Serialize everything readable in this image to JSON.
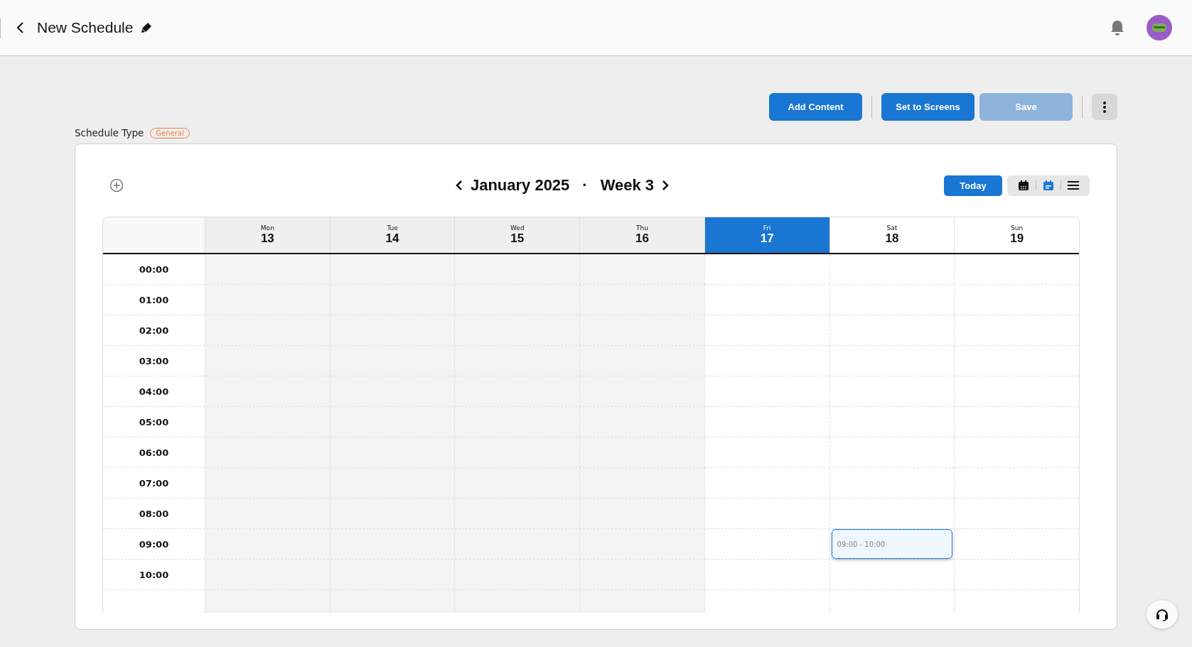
{
  "header": {
    "title": "New Schedule"
  },
  "toolbar": {
    "buttons": [
      {
        "label": "Add Content",
        "disabled": false
      },
      {
        "label": "Set to Screens",
        "disabled": false
      },
      {
        "label": "Save",
        "disabled": true
      }
    ]
  },
  "schedule_type": {
    "label": "Schedule Type",
    "badge": "General"
  },
  "calendar": {
    "month": "January 2025",
    "separator": "·",
    "week": "Week 3",
    "today_button": "Today",
    "views": [
      {
        "kind": "month",
        "selected": false
      },
      {
        "kind": "week",
        "selected": true
      },
      {
        "kind": "list",
        "selected": false
      }
    ],
    "days": [
      {
        "weekday": "Mon",
        "date": "13",
        "past": true,
        "selected": false
      },
      {
        "weekday": "Tue",
        "date": "14",
        "past": true,
        "selected": false
      },
      {
        "weekday": "Wed",
        "date": "15",
        "past": true,
        "selected": false
      },
      {
        "weekday": "Thu",
        "date": "16",
        "past": true,
        "selected": false
      },
      {
        "weekday": "Fri",
        "date": "17",
        "past": false,
        "selected": true
      },
      {
        "weekday": "Sat",
        "date": "18",
        "past": false,
        "selected": false
      },
      {
        "weekday": "Sun",
        "date": "19",
        "past": false,
        "selected": false
      }
    ],
    "hours": [
      {
        "time": "00:00"
      },
      {
        "time": "01:00"
      },
      {
        "time": "02:00"
      },
      {
        "time": "03:00"
      },
      {
        "time": "04:00"
      },
      {
        "time": "05:00"
      },
      {
        "time": "06:00"
      },
      {
        "time": "07:00"
      },
      {
        "time": "08:00"
      },
      {
        "time": "09:00",
        "cells": [
          null,
          null,
          null,
          null,
          null,
          {
            "event": "09:00 - 10:00"
          },
          null
        ]
      },
      {
        "time": "10:00"
      }
    ]
  }
}
